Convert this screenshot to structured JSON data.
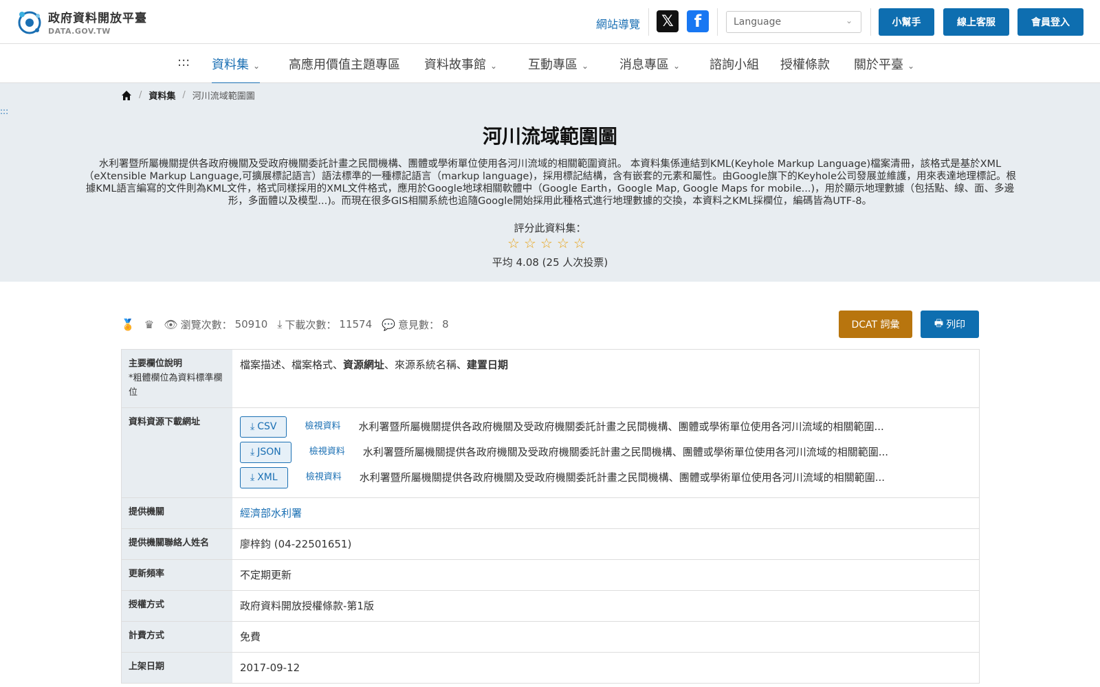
{
  "header": {
    "logo_cn": "政府資料開放平臺",
    "logo_en": "DATA.GOV.TW",
    "sitemap": "網站導覽",
    "language_placeholder": "Language",
    "buttons": [
      "小幫手",
      "線上客服",
      "會員登入"
    ]
  },
  "nav": {
    "accesskey": ":::",
    "items": [
      {
        "label": "資料集",
        "dropdown": true,
        "active": true
      },
      {
        "label": "高應用價值主題專區",
        "dropdown": false
      },
      {
        "label": "資料故事館",
        "dropdown": true
      },
      {
        "label": "互動專區",
        "dropdown": true
      },
      {
        "label": "消息專區",
        "dropdown": true
      },
      {
        "label": "諮詢小組",
        "dropdown": false
      },
      {
        "label": "授權條款",
        "dropdown": false
      },
      {
        "label": "關於平臺",
        "dropdown": true
      }
    ]
  },
  "breadcrumb": {
    "home_icon": "home-icon",
    "items": [
      "資料集",
      "河川流域範圍圖"
    ],
    "separator": "/"
  },
  "hero": {
    "accesskey": ":::",
    "title": "河川流域範圍圖",
    "description": "水利署暨所屬機關提供各政府機關及受政府機關委託計畫之民間機構、團體或學術單位使用各河川流域的相關範圍資訊。 本資料集係連結到KML(Keyhole Markup Language)檔案清冊，該格式是基於XML（eXtensible Markup Language,可擴展標記語言）語法標準的一種標記語言（markup language)，採用標記結構，含有嵌套的元素和屬性。由Google旗下的Keyhole公司發展並維護，用來表達地理標記。根據KML語言編寫的文件則為KML文件，格式同樣採用的XML文件格式，應用於Google地球相關軟體中（Google Earth，Google Map, Google Maps for mobile...)，用於顯示地理數據（包括點、線、面、多邊形，多面體以及模型...)。而現在很多GIS相關系統也追隨Google開始採用此種格式進行地理數據的交換，本資料之KML採欄位，編碼皆為UTF-8。",
    "rating_label": "評分此資料集：",
    "star_count": 5,
    "rating_average": "平均 4.08 (25 人次投票)"
  },
  "stats": {
    "views_label": "瀏覽次數：",
    "views": "50910",
    "downloads_label": "下載次數：",
    "downloads": "11574",
    "comments_label": "意見數：",
    "comments": "8",
    "dcat_button": "DCAT 詞彙",
    "print_button": "列印"
  },
  "table": {
    "main_fields": {
      "label": "主要欄位說明",
      "sublabel": "*粗體欄位為資料標準欄位",
      "value_parts": [
        {
          "text": "檔案描述、檔案格式、",
          "bold": false
        },
        {
          "text": "資源網址",
          "bold": true
        },
        {
          "text": "、來源系統名稱、",
          "bold": false
        },
        {
          "text": "建置日期",
          "bold": true
        }
      ]
    },
    "resources": {
      "label": "資料資源下載網址",
      "items": [
        {
          "format": "CSV",
          "view": "檢視資料",
          "desc": "水利署暨所屬機關提供各政府機關及受政府機關委託計畫之民間機構、團體或學術單位使用各河川流域的相關範圍..."
        },
        {
          "format": "JSON",
          "view": "檢視資料",
          "desc": "水利署暨所屬機關提供各政府機關及受政府機關委託計畫之民間機構、團體或學術單位使用各河川流域的相關範圍..."
        },
        {
          "format": "XML",
          "view": "檢視資料",
          "desc": "水利署暨所屬機關提供各政府機關及受政府機關委託計畫之民間機構、團體或學術單位使用各河川流域的相關範圍..."
        }
      ]
    },
    "rows": [
      {
        "label": "提供機關",
        "value": "經濟部水利署",
        "link": true
      },
      {
        "label": "提供機關聯絡人姓名",
        "value": "廖梓鈞 (04-22501651)",
        "link": false
      },
      {
        "label": "更新頻率",
        "value": "不定期更新",
        "link": false
      },
      {
        "label": "授權方式",
        "value": "政府資料開放授權條款-第1版",
        "link": false
      },
      {
        "label": "計費方式",
        "value": "免費",
        "link": false
      },
      {
        "label": "上架日期",
        "value": "2017-09-12",
        "link": false
      }
    ]
  }
}
